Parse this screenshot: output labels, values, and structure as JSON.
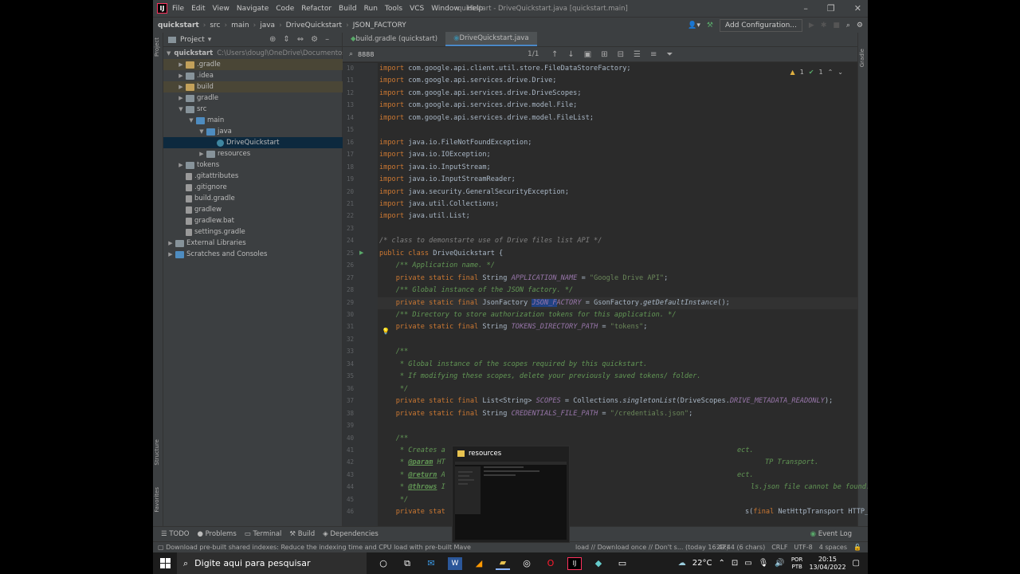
{
  "titlebar": {
    "logo": "IJ",
    "menu": [
      "File",
      "Edit",
      "View",
      "Navigate",
      "Code",
      "Refactor",
      "Build",
      "Run",
      "Tools",
      "VCS",
      "Window",
      "Help"
    ],
    "title": "quickstart - DriveQuickstart.java [quickstart.main]"
  },
  "navbar": {
    "crumbs": [
      "quickstart",
      "src",
      "main",
      "java",
      "DriveQuickstart",
      "JSON_FACTORY"
    ],
    "config_label": "Add Configuration..."
  },
  "sidestrip": {
    "left_top": "Project",
    "left_mid": "Structure",
    "left_bot": "Favorites",
    "right_top": "Gradle"
  },
  "project": {
    "title": "Project",
    "items": [
      {
        "label": "quickstart",
        "extra": "C:\\Users\\dougl\\OneDrive\\Documentos\\Quickstart",
        "indent": 0,
        "arrow": "v",
        "icon": "folder-b"
      },
      {
        "label": ".gradle",
        "indent": 1,
        "arrow": ">",
        "icon": "folder-o"
      },
      {
        "label": ".idea",
        "indent": 1,
        "arrow": ">",
        "icon": "folder"
      },
      {
        "label": "build",
        "indent": 1,
        "arrow": ">",
        "icon": "folder-o"
      },
      {
        "label": "gradle",
        "indent": 1,
        "arrow": ">",
        "icon": "folder"
      },
      {
        "label": "src",
        "indent": 1,
        "arrow": "v",
        "icon": "folder"
      },
      {
        "label": "main",
        "indent": 2,
        "arrow": "v",
        "icon": "folder-b"
      },
      {
        "label": "java",
        "indent": 3,
        "arrow": "v",
        "icon": "folder-b"
      },
      {
        "label": "DriveQuickstart",
        "indent": 4,
        "arrow": "",
        "icon": "cls"
      },
      {
        "label": "resources",
        "indent": 3,
        "arrow": ">",
        "icon": "folder"
      },
      {
        "label": "tokens",
        "indent": 1,
        "arrow": ">",
        "icon": "folder"
      },
      {
        "label": ".gitattributes",
        "indent": 1,
        "arrow": "",
        "icon": "file"
      },
      {
        "label": ".gitignore",
        "indent": 1,
        "arrow": "",
        "icon": "file"
      },
      {
        "label": "build.gradle",
        "indent": 1,
        "arrow": "",
        "icon": "file"
      },
      {
        "label": "gradlew",
        "indent": 1,
        "arrow": "",
        "icon": "file"
      },
      {
        "label": "gradlew.bat",
        "indent": 1,
        "arrow": "",
        "icon": "file"
      },
      {
        "label": "settings.gradle",
        "indent": 1,
        "arrow": "",
        "icon": "file"
      },
      {
        "label": "External Libraries",
        "indent": 0,
        "arrow": ">",
        "icon": "folder"
      },
      {
        "label": "Scratches and Consoles",
        "indent": 0,
        "arrow": ">",
        "icon": "folder-b"
      }
    ]
  },
  "editor": {
    "tabs": [
      {
        "label": "build.gradle (quickstart)",
        "active": false
      },
      {
        "label": "DriveQuickstart.java",
        "active": true
      }
    ],
    "find": {
      "query": "8888",
      "count": "1/1"
    },
    "inspection": {
      "warnings": "1",
      "checks": "1"
    },
    "lines": [
      {
        "n": "10",
        "html": "<span class='kw'>import</span> com.google.api.client.util.store.FileDataStoreFactory;"
      },
      {
        "n": "11",
        "html": "<span class='kw'>import</span> com.google.api.services.drive.Drive;"
      },
      {
        "n": "12",
        "html": "<span class='kw'>import</span> com.google.api.services.drive.DriveScopes;"
      },
      {
        "n": "13",
        "html": "<span class='kw'>import</span> com.google.api.services.drive.model.File;"
      },
      {
        "n": "14",
        "html": "<span class='kw'>import</span> com.google.api.services.drive.model.FileList;"
      },
      {
        "n": "15",
        "html": ""
      },
      {
        "n": "16",
        "html": "<span class='kw'>import</span> java.io.FileNotFoundException;"
      },
      {
        "n": "17",
        "html": "<span class='kw'>import</span> java.io.IOException;"
      },
      {
        "n": "18",
        "html": "<span class='kw'>import</span> java.io.InputStream;"
      },
      {
        "n": "19",
        "html": "<span class='kw'>import</span> java.io.InputStreamReader;"
      },
      {
        "n": "20",
        "html": "<span class='kw'>import</span> java.security.GeneralSecurityException;"
      },
      {
        "n": "21",
        "html": "<span class='kw'>import</span> java.util.Collections;"
      },
      {
        "n": "22",
        "html": "<span class='kw'>import</span> java.util.List;"
      },
      {
        "n": "23",
        "html": ""
      },
      {
        "n": "24",
        "html": "<span class='cm'>/* class to demonstarte use of Drive files list API */</span>"
      },
      {
        "n": "25",
        "html": "<span class='kw'>public class</span> DriveQuickstart {"
      },
      {
        "n": "26",
        "html": "    <span class='dc'>/** Application name. */</span>"
      },
      {
        "n": "27",
        "html": "    <span class='kw'>private static final</span> String <span class='fd'>APPLICATION_NAME</span> = <span class='st'>\"Google Drive API\"</span>;"
      },
      {
        "n": "28",
        "html": "    <span class='dc'>/** Global instance of the JSON factory. */</span>"
      },
      {
        "n": "29",
        "html": "    <span class='kw'>private static final</span> JsonFactory <span class='fd'><span class='selx'>JSON_F</span>ACTORY</span> = GsonFactory.<span class='mt'>getDefaultInstance</span>();"
      },
      {
        "n": "30",
        "html": "    <span class='dc'>/** Directory to store authorization tokens for this application. */</span>"
      },
      {
        "n": "31",
        "html": "    <span class='kw'>private static final</span> String <span class='fd'>TOKENS_DIRECTORY_PATH</span> = <span class='st'>\"tokens\"</span>;"
      },
      {
        "n": "32",
        "html": ""
      },
      {
        "n": "33",
        "html": "    <span class='dc'>/**</span>"
      },
      {
        "n": "34",
        "html": "    <span class='dc'> * Global instance of the scopes required by this quickstart.</span>"
      },
      {
        "n": "35",
        "html": "    <span class='dc'> * If modifying these scopes, delete your previously saved tokens/ folder.</span>"
      },
      {
        "n": "36",
        "html": "    <span class='dc'> */</span>"
      },
      {
        "n": "37",
        "html": "    <span class='kw'>private static final</span> List&lt;String&gt; <span class='fd'>SCOPES</span> = Collections.<span class='mt'>singletonList</span>(DriveScopes.<span class='fd'>DRIVE_METADATA_READONLY</span>);"
      },
      {
        "n": "38",
        "html": "    <span class='kw'>private static final</span> String <span class='fd'>CREDENTIALS_FILE_PATH</span> = <span class='st'>\"/credentials.json\"</span>;"
      },
      {
        "n": "39",
        "html": ""
      },
      {
        "n": "40",
        "html": "    <span class='dc'>/**</span>"
      },
      {
        "n": "41",
        "html": "    <span class='dc'> * Creates a</span>"
      },
      {
        "n": "42",
        "html": "    <span class='dc'> * </span><span class='tg'>@param</span><span class='dc'> HT</span>"
      },
      {
        "n": "43",
        "html": "    <span class='dc'> * </span><span class='tg'>@return</span><span class='dc'> A</span>"
      },
      {
        "n": "44",
        "html": "    <span class='dc'> * </span><span class='tg'>@throws</span><span class='dc'> I</span>"
      },
      {
        "n": "45",
        "html": "    <span class='dc'> */</span>"
      },
      {
        "n": "46",
        "html": "    <span class='kw'>private stat</span>"
      }
    ],
    "peek": [
      {
        "n": "41",
        "html": "<span class='dc'>ect.</span>"
      },
      {
        "n": "42",
        "html": "<span class='dc'>TP Transport.</span>"
      },
      {
        "n": "43",
        "html": "<span class='dc'>ect.</span>"
      },
      {
        "n": "44",
        "html": "<span class='dc'>ls.json file cannot be found.</span>"
      },
      {
        "n": "46",
        "html": "s(<span class='kw'>final</span> NetHttpTransport HTTP_TRANSPORT) <span class='kw'>throws</span> IOException {"
      }
    ]
  },
  "toolwindows": {
    "todo": "TODO",
    "problems": "Problems",
    "terminal": "Terminal",
    "build": "Build",
    "dependencies": "Dependencies",
    "event_log": "Event Log"
  },
  "status": {
    "message": "Download pre-built shared indexes: Reduce the indexing time and CPU load with pre-built Mave",
    "message2": "load // Download once // Don't s... (today 16:47)",
    "position": "29:44 (6 chars)",
    "line_sep": "CRLF",
    "encoding": "UTF-8",
    "indent": "4 spaces"
  },
  "preview": {
    "title": "resources"
  },
  "taskbar": {
    "search_placeholder": "Digite aqui para pesquisar",
    "temperature": "22°C",
    "lang_top": "POR",
    "lang_bot": "PTB",
    "time": "20:15",
    "date": "13/04/2022"
  }
}
